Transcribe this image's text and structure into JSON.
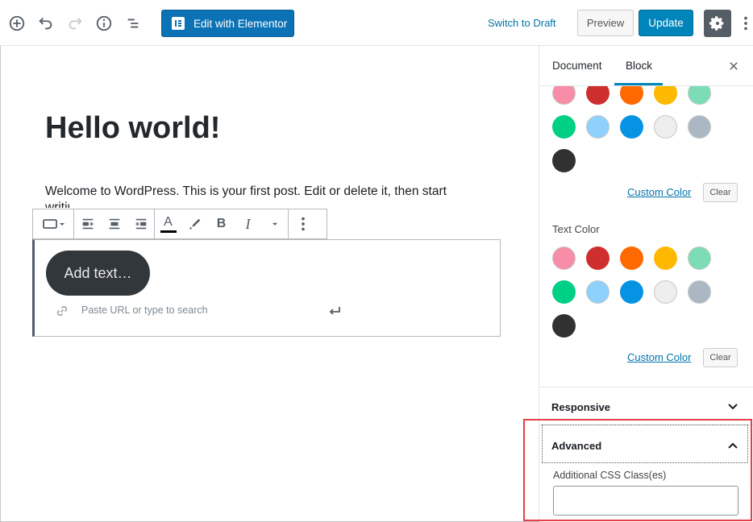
{
  "topbar": {
    "elementor_label": "Edit with Elementor",
    "switch_draft_label": "Switch to Draft",
    "preview_label": "Preview",
    "update_label": "Update"
  },
  "editor": {
    "title": "Hello world!",
    "paragraph": "Welcome to WordPress. This is your first post. Edit or delete it, then start",
    "paragraph_tail": "writing!",
    "button_text": "Add text…",
    "url_placeholder": "Paste URL or type to search",
    "toolbar": {
      "text_color_icon": "A",
      "bold_icon": "B",
      "italic_icon": "I"
    }
  },
  "sidebar": {
    "tabs": [
      {
        "label": "Document"
      },
      {
        "label": "Block"
      }
    ],
    "background_color": {
      "custom_color_label": "Custom Color",
      "clear_label": "Clear"
    },
    "text_color": {
      "label": "Text Color",
      "custom_color_label": "Custom Color",
      "clear_label": "Clear"
    },
    "palette": [
      "#f78da7",
      "#cf2e2e",
      "#ff6900",
      "#fcb900",
      "#7bdcb5",
      "#00d084",
      "#8ed1fc",
      "#0693e3",
      "#eeeeee",
      "#abb8c3",
      "#313131"
    ],
    "panels": {
      "responsive": "Responsive",
      "advanced": "Advanced",
      "css_class_label": "Additional CSS Class(es)",
      "css_class_value": ""
    }
  },
  "colors": {
    "primary": "#0085ba",
    "elementor": "#0b72b5",
    "highlight": "#e4404a"
  }
}
